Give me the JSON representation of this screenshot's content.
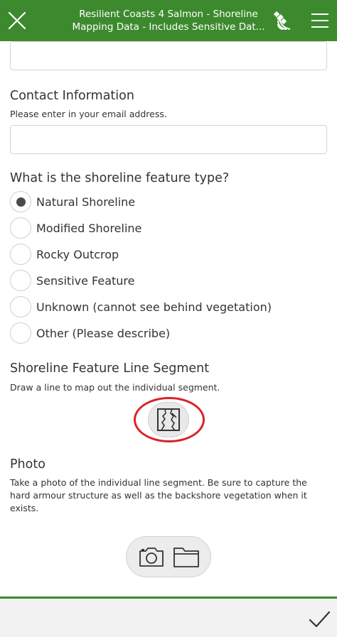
{
  "header": {
    "title_line1": "Resilient Coasts 4 Salmon - Shoreline",
    "title_line2": "Mapping Data - Includes Sensitive Dat..."
  },
  "form": {
    "top_field_value": "",
    "contact": {
      "label": "Contact Information",
      "hint": "Please enter in your email address.",
      "value": ""
    },
    "feature_type": {
      "label": "What is the shoreline feature type?",
      "selected": "Natural Shoreline",
      "options": [
        "Natural Shoreline",
        "Modified Shoreline",
        "Rocky Outcrop",
        "Sensitive Feature",
        "Unknown (cannot see behind vegetation)",
        "Other (Please describe)"
      ]
    },
    "line_segment": {
      "label": "Shoreline Feature Line Segment",
      "hint": "Draw a line to map out the individual segment."
    },
    "photo": {
      "label": "Photo",
      "hint_line1": "Take a photo of the individual line segment. Be sure to capture the",
      "hint_line2": "hard armour structure as well as the backshore vegetation when it",
      "hint_line3": "exists."
    }
  },
  "icons": {
    "close": "close-icon",
    "gps": "gps-satellite-icon",
    "menu": "menu-icon",
    "map_draw": "map-draw-icon",
    "camera": "camera-icon",
    "folder": "folder-icon",
    "submit": "checkmark-icon"
  },
  "colors": {
    "header_green": "#3d8a2e",
    "annotation_red": "#d9222a",
    "footer_gray": "#f2f2f2"
  }
}
